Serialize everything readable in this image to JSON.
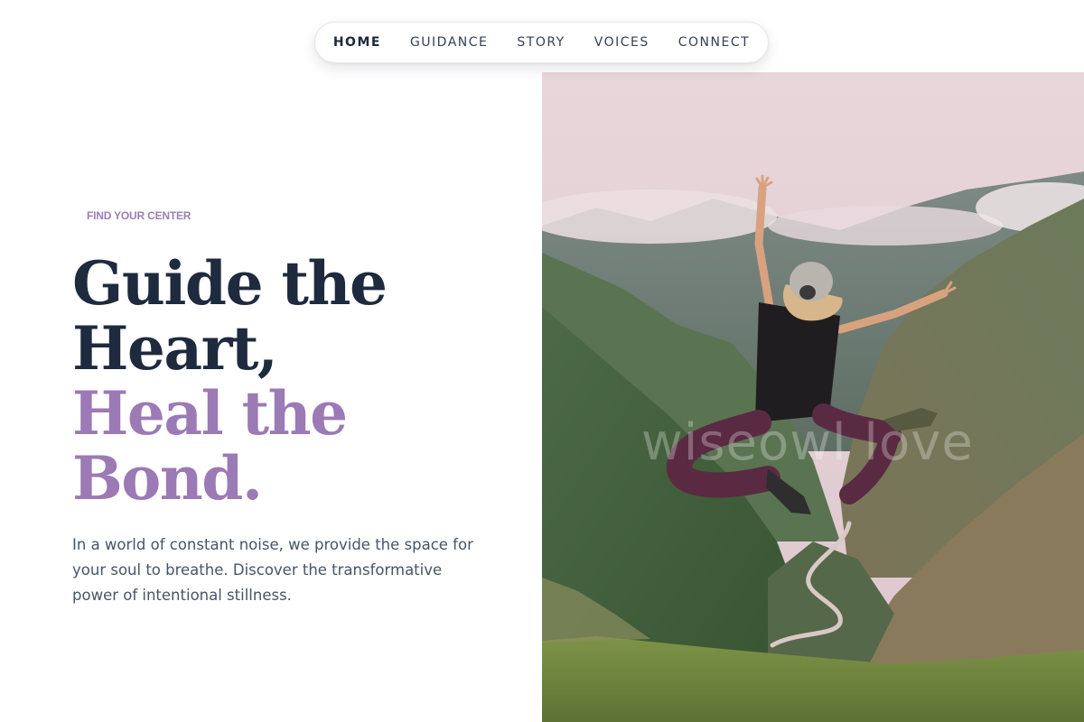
{
  "nav": {
    "items": [
      {
        "label": "HOME",
        "active": true
      },
      {
        "label": "GUIDANCE",
        "active": false
      },
      {
        "label": "STORY",
        "active": false
      },
      {
        "label": "VOICES",
        "active": false
      },
      {
        "label": "CONNECT",
        "active": false
      }
    ]
  },
  "hero": {
    "kicker": "FIND YOUR CENTER",
    "headline_lines": [
      "Guide the",
      "Heart,",
      "Heal the",
      "Bond."
    ],
    "lead": "In a world of constant noise, we provide the space for your soul to breathe. Discover the transformative power of intentional stillness.",
    "image_watermark": "wiseowl love"
  },
  "colors": {
    "accent": "#9b7ab5",
    "heading": "#1e2a3e",
    "body_text": "#475569"
  }
}
